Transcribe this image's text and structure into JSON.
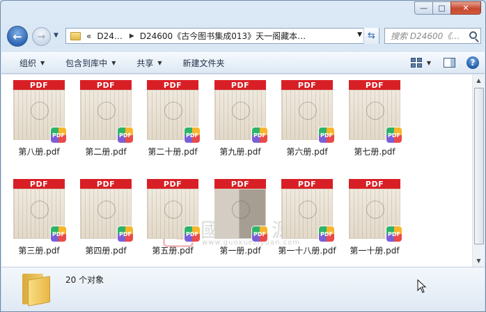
{
  "window": {
    "caption_min": "—",
    "caption_max": "□",
    "caption_close": "✕"
  },
  "address": {
    "overflow": "«",
    "crumb1": "D24…",
    "crumb2": "D24600《古今图书集成013》天一阁藏本…",
    "placeholder_search": "搜索 D24600《…"
  },
  "toolbar": {
    "organize": "组织",
    "include_library": "包含到库中",
    "share": "共享",
    "new_folder": "新建文件夹"
  },
  "files": [
    {
      "name": "第八册.pdf"
    },
    {
      "name": "第二册.pdf"
    },
    {
      "name": "第二十册.pdf"
    },
    {
      "name": "第九册.pdf"
    },
    {
      "name": "第六册.pdf"
    },
    {
      "name": "第七册.pdf"
    },
    {
      "name": "第三册.pdf"
    },
    {
      "name": "第四册.pdf"
    },
    {
      "name": "第五册.pdf"
    },
    {
      "name": "第一册.pdf"
    },
    {
      "name": "第一十八册.pdf"
    },
    {
      "name": "第一十册.pdf"
    }
  ],
  "thumb": {
    "band_label": "PDF",
    "badge_label": "PDF"
  },
  "watermark": {
    "seal": "臨",
    "title": "國學資源網",
    "url": "www.guoxueziyuan.com"
  },
  "status": {
    "count": "20 个对象"
  },
  "colors": {
    "pdf_red": "#d81f26",
    "toolbar_bg": "#e8f0f8"
  }
}
